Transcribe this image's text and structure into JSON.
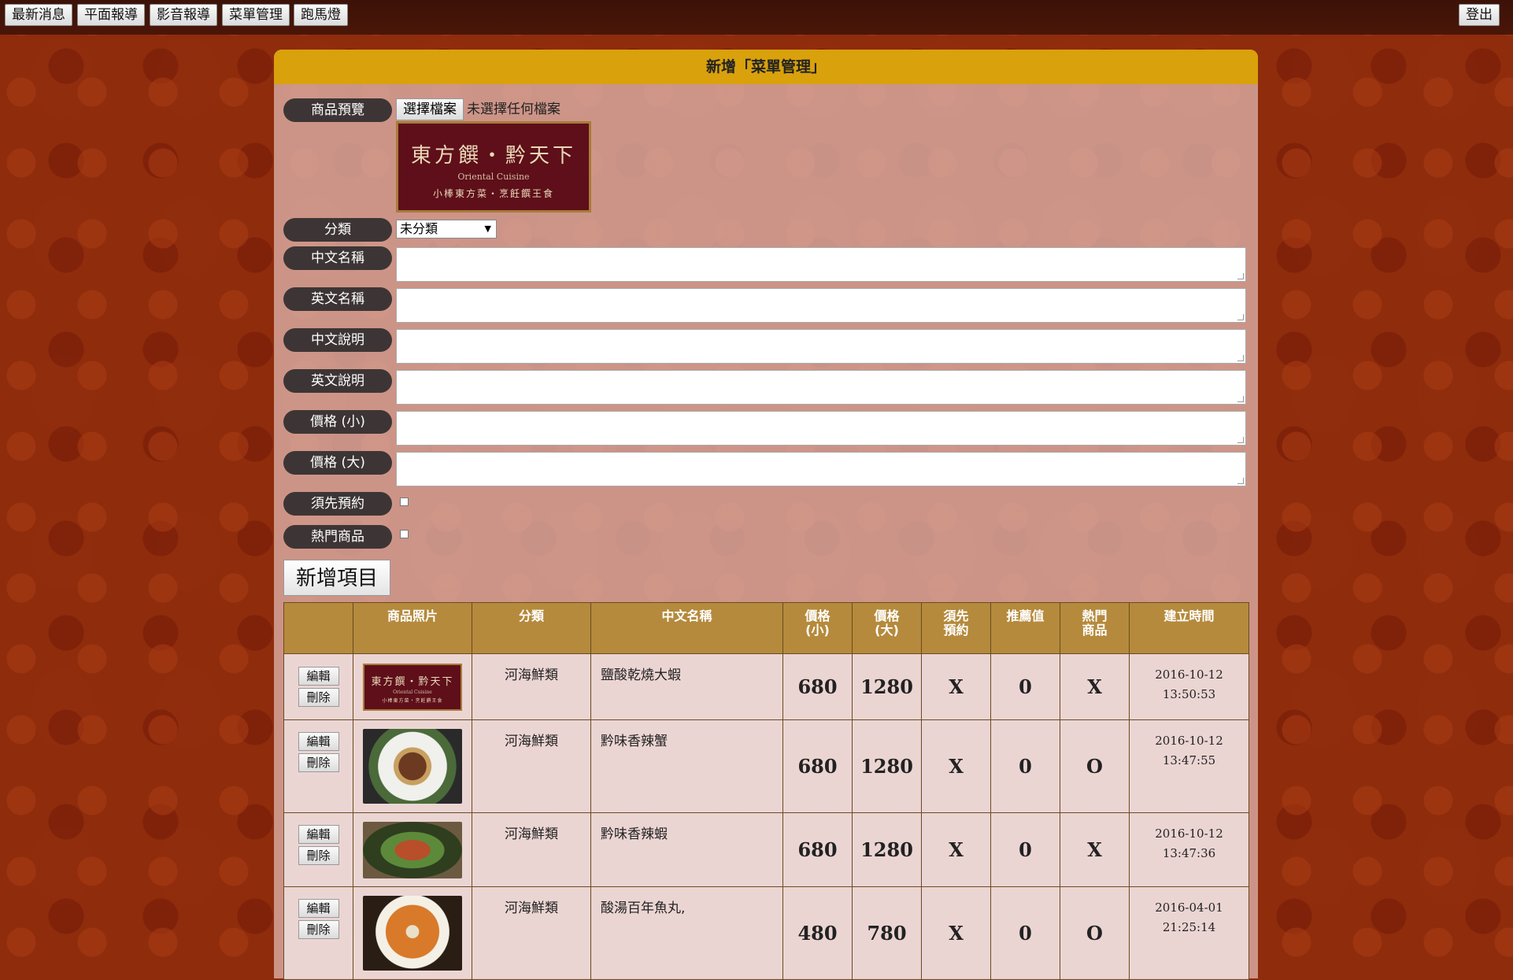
{
  "nav": {
    "items": [
      "最新消息",
      "平面報導",
      "影音報導",
      "菜單管理",
      "跑馬燈"
    ],
    "logout": "登出"
  },
  "form": {
    "title": "新增「菜單管理」",
    "labels": {
      "preview": "商品預覽",
      "category": "分類",
      "name_zh": "中文名稱",
      "name_en": "英文名稱",
      "desc_zh": "中文說明",
      "desc_en": "英文說明",
      "price_small": "價格 (小)",
      "price_large": "價格 (大)",
      "reservation": "須先預約",
      "hot": "熱門商品"
    },
    "file_button": "選擇檔案",
    "file_status": "未選擇任何檔案",
    "category_selected": "未分類",
    "submit": "新增項目"
  },
  "logo": {
    "title": "東方饌・黔天下",
    "subtitle": "Oriental Cuisine",
    "tagline": "小棒東方菜・烹飪饌王食"
  },
  "table": {
    "headers": [
      "",
      "商品照片",
      "分類",
      "中文名稱",
      "價格\n(小)",
      "價格\n(大)",
      "須先\n預約",
      "推薦值",
      "熱門\n商品",
      "建立時間"
    ],
    "edit_label": "編輯",
    "delete_label": "刪除",
    "rows": [
      {
        "photo": "logo",
        "category": "河海鮮類",
        "name": "鹽酸乾燒大蝦",
        "price_small": "680",
        "price_large": "1280",
        "reservation": "X",
        "recommend": "0",
        "hot": "X",
        "date": "2016-10-12",
        "time": "13:50:53"
      },
      {
        "photo": "crab",
        "category": "河海鮮類",
        "name": "黔味香辣蟹",
        "price_small": "680",
        "price_large": "1280",
        "reservation": "X",
        "recommend": "0",
        "hot": "O",
        "date": "2016-10-12",
        "time": "13:47:55"
      },
      {
        "photo": "shrimp",
        "category": "河海鮮類",
        "name": "黔味香辣蝦",
        "price_small": "680",
        "price_large": "1280",
        "reservation": "X",
        "recommend": "0",
        "hot": "X",
        "date": "2016-10-12",
        "time": "13:47:36"
      },
      {
        "photo": "soup",
        "category": "河海鮮類",
        "name": "酸湯百年魚丸,",
        "price_small": "480",
        "price_large": "780",
        "reservation": "X",
        "recommend": "0",
        "hot": "O",
        "date": "2016-04-01",
        "time": "21:25:14"
      }
    ]
  },
  "colors": {
    "background": "#8e2c0c",
    "panel_header": "#d9a10c",
    "label_pill": "#3d3535",
    "table_header": "#b58a3c"
  }
}
